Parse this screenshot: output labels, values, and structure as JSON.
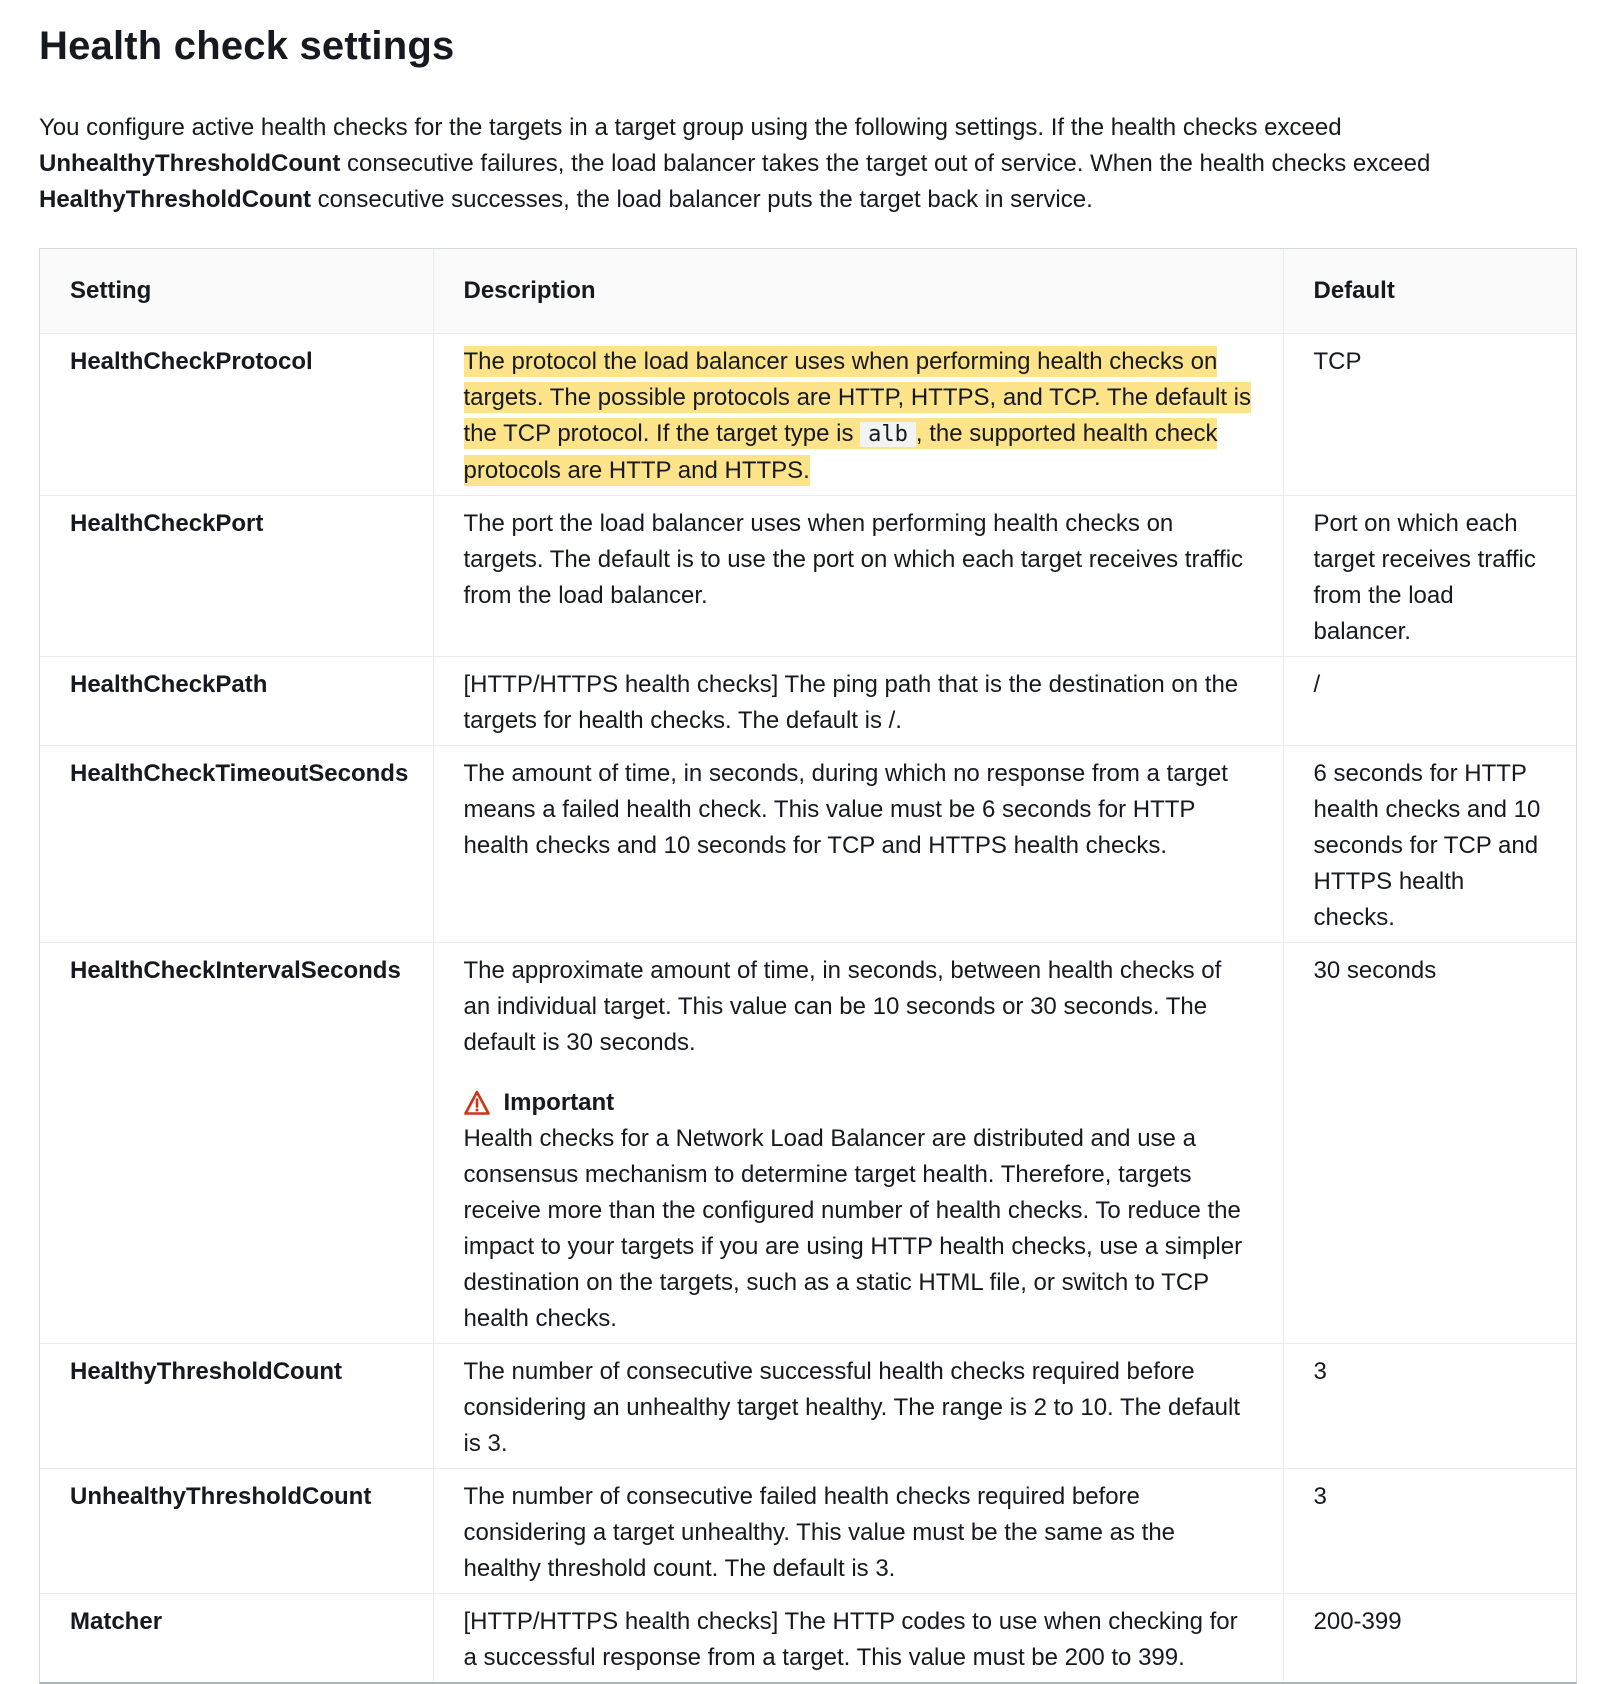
{
  "title": "Health check settings",
  "intro": {
    "p1": "You configure active health checks for the targets in a target group using the following settings. If the health checks exceed ",
    "b1": "UnhealthyThresholdCount",
    "p2": " consecutive failures, the load balancer takes the target out of service. When the health checks exceed ",
    "b2": "HealthyThresholdCount",
    "p3": " consecutive successes, the load balancer puts the target back in service."
  },
  "table": {
    "headers": [
      "Setting",
      "Description",
      "Default"
    ],
    "rows": [
      {
        "setting": "HealthCheckProtocol",
        "desc_a": "The protocol the load balancer uses when performing health checks on targets. The possible protocols are HTTP, HTTPS, and TCP. The default is the TCP protocol. If the target type is ",
        "desc_code": "alb",
        "desc_b": ", the supported health check protocols are HTTP and HTTPS.",
        "default": "TCP"
      },
      {
        "setting": "HealthCheckPort",
        "desc": "The port the load balancer uses when performing health checks on targets. The default is to use the port on which each target receives traffic from the load balancer.",
        "default": "Port on which each target receives traffic from the load balancer."
      },
      {
        "setting": "HealthCheckPath",
        "desc": "[HTTP/HTTPS health checks] The ping path that is the destination on the targets for health checks. The default is /.",
        "default": "/"
      },
      {
        "setting": "HealthCheckTimeoutSeconds",
        "desc": "The amount of time, in seconds, during which no response from a target means a failed health check. This value must be 6 seconds for HTTP health checks and 10 seconds for TCP and HTTPS health checks.",
        "default": "6 seconds for HTTP health checks and 10 seconds for TCP and HTTPS health checks."
      },
      {
        "setting": "HealthCheckIntervalSeconds",
        "desc": "The approximate amount of time, in seconds, between health checks of an individual target. This value can be 10 seconds or 30 seconds. The default is 30 seconds.",
        "important_label": "Important",
        "important_text": "Health checks for a Network Load Balancer are distributed and use a consensus mechanism to determine target health. Therefore, targets receive more than the configured number of health checks. To reduce the impact to your targets if you are using HTTP health checks, use a simpler destination on the targets, such as a static HTML file, or switch to TCP health checks.",
        "default": "30 seconds"
      },
      {
        "setting": "HealthyThresholdCount",
        "desc": "The number of consecutive successful health checks required before considering an unhealthy target healthy. The range is 2 to 10. The default is 3.",
        "default": "3"
      },
      {
        "setting": "UnhealthyThresholdCount",
        "desc": "The number of consecutive failed health checks required before considering a target unhealthy. This value must be the same as the healthy threshold count. The default is 3.",
        "default": "3"
      },
      {
        "setting": "Matcher",
        "desc": "[HTTP/HTTPS health checks] The HTTP codes to use when checking for a successful response from a target. This value must be 200 to 399.",
        "default": "200-399"
      }
    ]
  },
  "colors": {
    "highlight": "#fde48a",
    "warning_icon": "#d13212",
    "text": "#16191f",
    "header_bg": "#fafafa"
  },
  "icons": {
    "important": "warning-triangle-icon"
  }
}
